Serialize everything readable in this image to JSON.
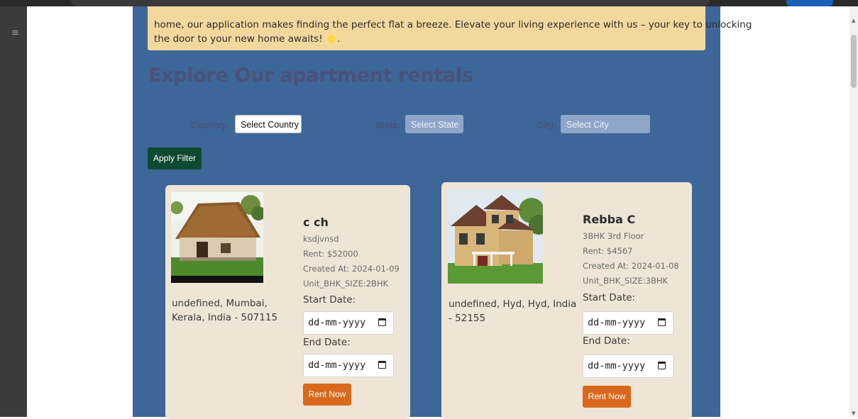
{
  "banner": {
    "line1": "home, our application makes finding the perfect flat a breeze. Elevate your living experience with us – your key to unlocking",
    "line2_text": "the door to your new home awaits!",
    "line2_end": "."
  },
  "page": {
    "title": "Explore Our apartment rentals"
  },
  "filters": {
    "country_label": "Country:",
    "country_value": "Select Country",
    "state_label": "State:",
    "state_value": "Select State",
    "city_label": "City:",
    "city_value": "Select City",
    "apply_label": "Apply Filter"
  },
  "listings": [
    {
      "name": "c ch",
      "description": "ksdjvnsd",
      "rent": "Rent: $52000",
      "created": "Created At: 2024-01-09",
      "unit": "Unit_BHK_SIZE:2BHK",
      "address": "undefined, Mumbai, Kerala, India - 507115",
      "start_label": "Start Date:",
      "end_label": "End Date:",
      "date_placeholder": "dd-mm-yyyy",
      "rent_button": "Rent Now"
    },
    {
      "name": "Rebba C",
      "description": "3BHK 3rd Floor",
      "rent": "Rent: $4567",
      "created": "Created At: 2024-01-08",
      "unit": "Unit_BHK_SIZE:3BHK",
      "address": "undefined, Hyd, Hyd, India - 52155",
      "start_label": "Start Date:",
      "end_label": "End Date:",
      "date_placeholder": "dd-mm-yyyy",
      "rent_button": "Rent Now"
    }
  ],
  "colors": {
    "page_background": "#3d6699",
    "banner": "#f3d89e",
    "card": "#efe5d6",
    "apply_button": "#0d4a30",
    "rent_button": "#d9691c",
    "heading": "#4a5278"
  }
}
